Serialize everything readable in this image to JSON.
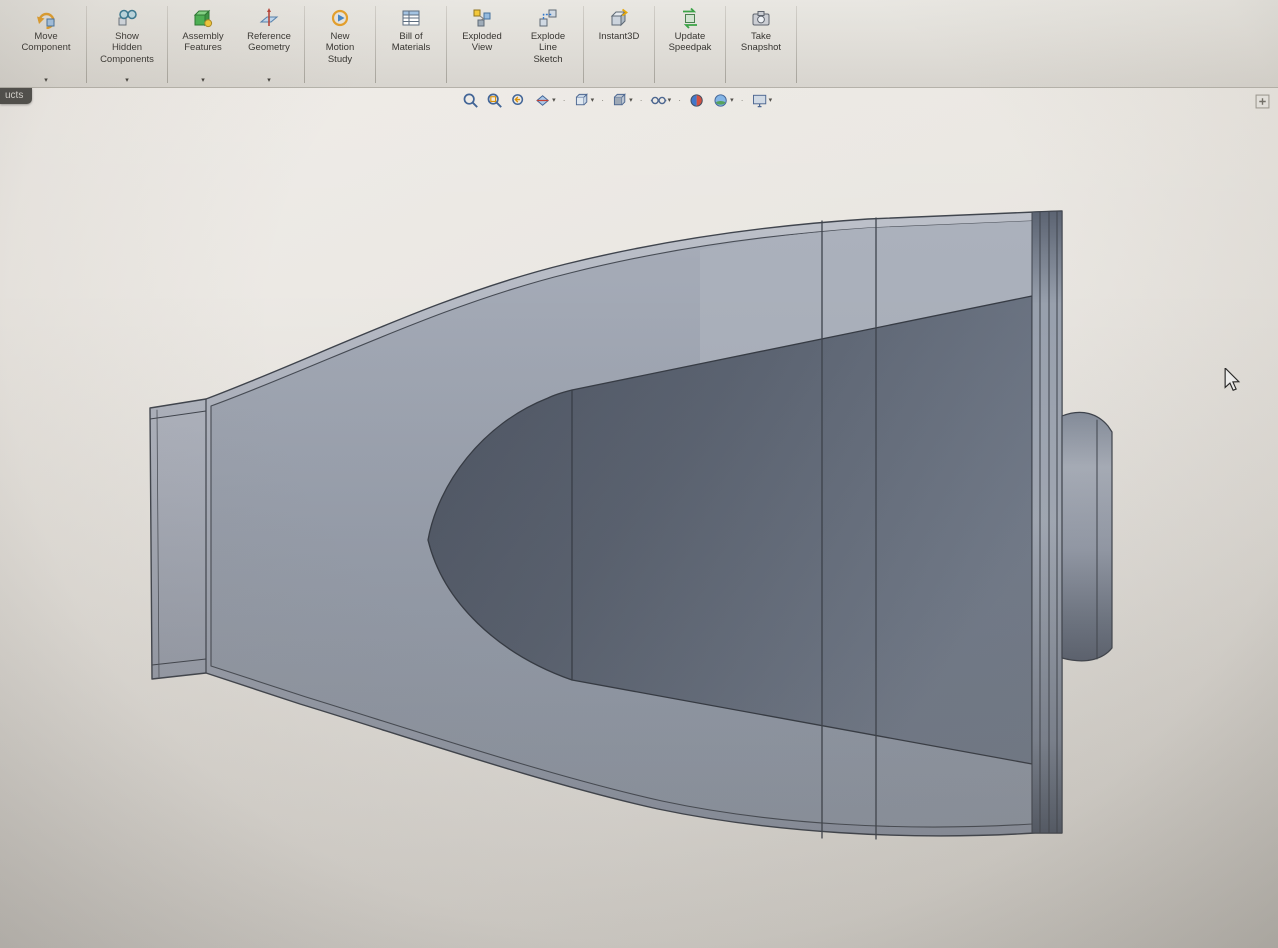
{
  "toolbar": {
    "buttons": [
      {
        "label": "Move\nComponent",
        "icon": "move-component-icon",
        "dropdown": true
      },
      {
        "label": "Show\nHidden\nComponents",
        "icon": "show-hidden-components-icon",
        "dropdown": true
      },
      {
        "label": "Assembly\nFeatures",
        "icon": "assembly-features-icon",
        "dropdown": true
      },
      {
        "label": "Reference\nGeometry",
        "icon": "reference-geometry-icon",
        "dropdown": true
      },
      {
        "label": "New\nMotion\nStudy",
        "icon": "new-motion-study-icon",
        "dropdown": false
      },
      {
        "label": "Bill of\nMaterials",
        "icon": "bill-of-materials-icon",
        "dropdown": false
      },
      {
        "label": "Exploded\nView",
        "icon": "exploded-view-icon",
        "dropdown": false
      },
      {
        "label": "Explode\nLine\nSketch",
        "icon": "explode-line-sketch-icon",
        "dropdown": false
      },
      {
        "label": "Instant3D",
        "icon": "instant3d-icon",
        "dropdown": false
      },
      {
        "label": "Update\nSpeedpak",
        "icon": "update-speedpak-icon",
        "dropdown": false
      },
      {
        "label": "Take\nSnapshot",
        "icon": "take-snapshot-icon",
        "dropdown": false
      }
    ]
  },
  "side_tab": {
    "label": "ucts"
  },
  "heads_up_toolbar": {
    "icons": [
      "zoom-to-fit",
      "zoom-to-area",
      "previous-view",
      "section-view",
      "view-orientation",
      "display-style",
      "hide-show-items",
      "edit-appearance",
      "apply-scene",
      "view-settings"
    ]
  },
  "viewport": {
    "model": "nacelle-assembly-section",
    "colors": {
      "shell": "#a9aeba",
      "interior": "#99a0ad",
      "center_body_dark": "#57606e",
      "background": "#e9e6e1",
      "edge_lines": "#3e434c"
    }
  }
}
